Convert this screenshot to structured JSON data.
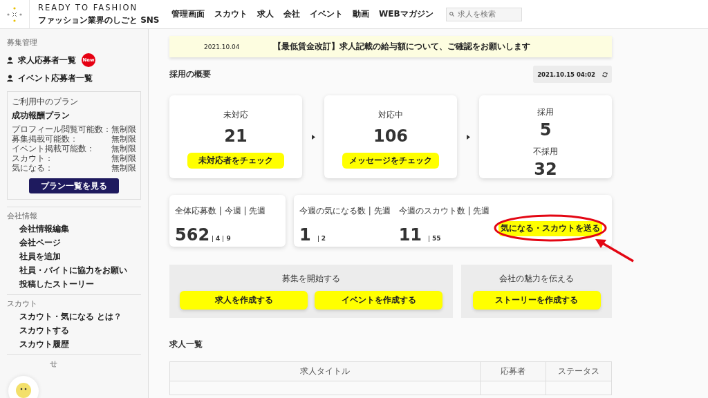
{
  "header": {
    "brand": "READY TO FASHION",
    "tagline": "ファッション業界のしごと SNS",
    "nav": [
      "管理画面",
      "スカウト",
      "求人",
      "会社",
      "イベント",
      "動画",
      "WEBマガジン"
    ],
    "search": {
      "placeholder": "求人を検索"
    }
  },
  "sidebar": {
    "section_title": "募集管理",
    "links": [
      {
        "label": "求人応募者一覧",
        "badge": "New"
      },
      {
        "label": "イベント応募者一覧"
      }
    ],
    "plan": {
      "caption": "ご利用中のプラン",
      "name": "成功報酬プラン",
      "rows": [
        {
          "label": "プロフィール閲覧可能数：",
          "value": "無制限"
        },
        {
          "label": "募集掲載可能数：",
          "value": "無制限"
        },
        {
          "label": "イベント掲載可能数：",
          "value": "無制限"
        },
        {
          "label": "スカウト：",
          "value": "無制限"
        },
        {
          "label": "気になる：",
          "value": "無制限"
        }
      ],
      "button": "プラン一覧を見る"
    },
    "sections": [
      {
        "title": "会社情報",
        "items": [
          "会社情報編集",
          "会社ページ",
          "社員を追加",
          "社員・バイトに協力をお願い",
          "投稿したストーリー"
        ]
      },
      {
        "title": "スカウト",
        "items": [
          "スカウト・気になる とは？",
          "スカウトする",
          "スカウト履歴"
        ]
      },
      {
        "title": "せ"
      }
    ]
  },
  "notice": {
    "date": "2021.10.04",
    "text": "【最低賃金改訂】求人記載の給与額について、ご確認をお願いします"
  },
  "overview": {
    "title": "採用の概要",
    "updated": "2021.10.15 04:02",
    "stages": [
      {
        "kind": "single",
        "label": "未対応",
        "count": "21",
        "button": "未対応者をチェック"
      },
      {
        "kind": "single",
        "label": "対応中",
        "count": "106",
        "button": "メッセージをチェック"
      },
      {
        "kind": "double",
        "items": [
          {
            "label": "採用",
            "count": "5"
          },
          {
            "label": "不採用",
            "count": "32"
          }
        ]
      }
    ],
    "totals": {
      "label": "全体応募数 | 今週 | 先週",
      "count": "562",
      "this_week": "4",
      "last_week": "9"
    },
    "weekly": [
      {
        "label": "今週の気になる数 | 先週",
        "count": "1",
        "last_week": "2"
      },
      {
        "label": "今週のスカウト数 | 先週",
        "count": "11",
        "last_week": "55"
      }
    ],
    "scout_button": {
      "label": "気になる・スカウトを送る",
      "highlighted": true
    }
  },
  "actions": [
    {
      "title": "募集を開始する",
      "buttons": [
        "求人を作成する",
        "イベントを作成する"
      ]
    },
    {
      "title": "会社の魅力を伝える",
      "buttons": [
        "ストーリーを作成する"
      ]
    }
  ],
  "jobs": {
    "title": "求人一覧",
    "columns": [
      "求人タイトル",
      "応募者",
      "ステータス"
    ]
  }
}
